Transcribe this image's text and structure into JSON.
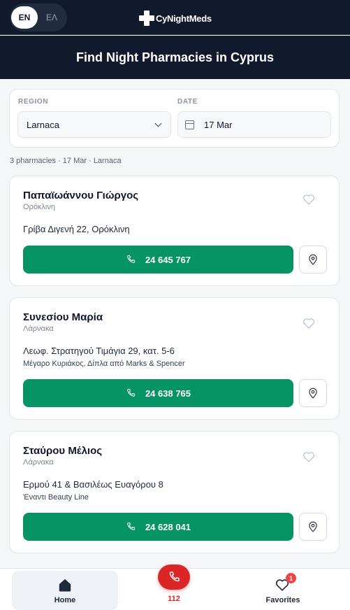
{
  "header": {
    "lang_en": "EN",
    "lang_el": "ΕΛ",
    "brand": "CyNightMeds",
    "title": "Find Night Pharmacies in Cyprus"
  },
  "filters": {
    "region_label": "REGION",
    "region_value": "Larnaca",
    "date_label": "DATE",
    "date_value": "17 Mar"
  },
  "results_meta": "3 pharmacies · 17 Mar · Larnaca",
  "pharmacies": [
    {
      "name": "Παπαϊωάννου Γιώργος",
      "town": "Ορόκλινη",
      "address": "Γρίβα Διγενή 22, Ορόκλινη",
      "note": "",
      "phone": "24 645 767"
    },
    {
      "name": "Συνεσίου Μαρία",
      "town": "Λάρνακα",
      "address": "Λεωφ. Στρατηγού Τιμάγια 29, κατ. 5-6",
      "note": "Μέγαρο Κυριάκος, Δίπλα από Marks & Spencer",
      "phone": "24 638 765"
    },
    {
      "name": "Σταύρου Μέλιος",
      "town": "Λάρνακα",
      "address": "Ερμού 41 & Βασιλέως Ευαγόρου 8",
      "note": "Έναντι Beauty Line",
      "phone": "24 628 041"
    }
  ],
  "bottom_nav": {
    "home": "Home",
    "emergency": "112",
    "favorites": "Favorites",
    "favorites_count": "1"
  },
  "colors": {
    "header_bg": "#111a2c",
    "call_green": "#069464",
    "emergency_red": "#dc2626"
  }
}
